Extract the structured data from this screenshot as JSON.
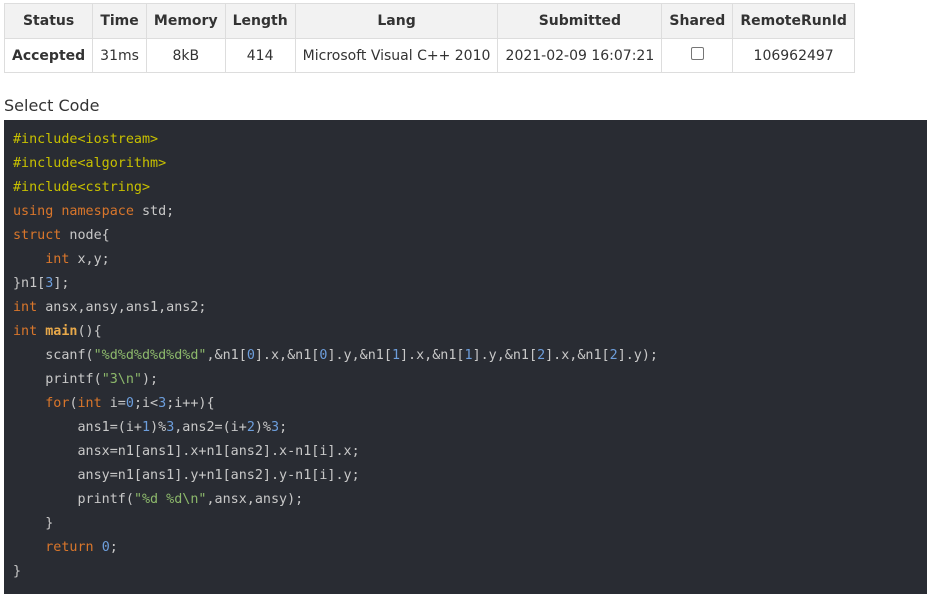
{
  "table": {
    "headers": [
      "Status",
      "Time",
      "Memory",
      "Length",
      "Lang",
      "Submitted",
      "Shared",
      "RemoteRunId"
    ],
    "row": {
      "status": "Accepted",
      "time": "31ms",
      "memory": "8kB",
      "length": "414",
      "lang": "Microsoft Visual C++ 2010",
      "submitted": "2021-02-09 16:07:21",
      "shared": false,
      "remote_run_id": "106962497"
    }
  },
  "select_code_label": "Select Code",
  "code_lines": [
    [
      [
        "pp",
        "#include<iostream>"
      ]
    ],
    [
      [
        "pp",
        "#include<algorithm>"
      ]
    ],
    [
      [
        "pp",
        "#include<cstring>"
      ]
    ],
    [
      [
        "kw",
        "using"
      ],
      [
        "pl",
        " "
      ],
      [
        "kw",
        "namespace"
      ],
      [
        "pl",
        " std;"
      ]
    ],
    [
      [
        "kw",
        "struct"
      ],
      [
        "pl",
        " node{"
      ]
    ],
    [
      [
        "pl",
        "    "
      ],
      [
        "kw",
        "int"
      ],
      [
        "pl",
        " x,y;"
      ]
    ],
    [
      [
        "pl",
        "}n1["
      ],
      [
        "num",
        "3"
      ],
      [
        "pl",
        "];"
      ]
    ],
    [
      [
        "kw",
        "int"
      ],
      [
        "pl",
        " ansx,ansy,ans1,ans2;"
      ]
    ],
    [
      [
        "kw",
        "int"
      ],
      [
        "pl",
        " "
      ],
      [
        "fn",
        "main"
      ],
      [
        "pl",
        "(){"
      ]
    ],
    [
      [
        "pl",
        "    scanf("
      ],
      [
        "str",
        "\"%d%d%d%d%d%d\""
      ],
      [
        "pl",
        ",&n1["
      ],
      [
        "num",
        "0"
      ],
      [
        "pl",
        "].x,&n1["
      ],
      [
        "num",
        "0"
      ],
      [
        "pl",
        "].y,&n1["
      ],
      [
        "num",
        "1"
      ],
      [
        "pl",
        "].x,&n1["
      ],
      [
        "num",
        "1"
      ],
      [
        "pl",
        "].y,&n1["
      ],
      [
        "num",
        "2"
      ],
      [
        "pl",
        "].x,&n1["
      ],
      [
        "num",
        "2"
      ],
      [
        "pl",
        "].y);"
      ]
    ],
    [
      [
        "pl",
        "    printf("
      ],
      [
        "str",
        "\"3\\n\""
      ],
      [
        "pl",
        ");"
      ]
    ],
    [
      [
        "pl",
        "    "
      ],
      [
        "kw",
        "for"
      ],
      [
        "pl",
        "("
      ],
      [
        "kw",
        "int"
      ],
      [
        "pl",
        " i="
      ],
      [
        "num",
        "0"
      ],
      [
        "pl",
        ";i<"
      ],
      [
        "num",
        "3"
      ],
      [
        "pl",
        ";i++){"
      ]
    ],
    [
      [
        "pl",
        "        ans1=(i+"
      ],
      [
        "num",
        "1"
      ],
      [
        "pl",
        ")%"
      ],
      [
        "num",
        "3"
      ],
      [
        "pl",
        ",ans2=(i+"
      ],
      [
        "num",
        "2"
      ],
      [
        "pl",
        ")%"
      ],
      [
        "num",
        "3"
      ],
      [
        "pl",
        ";"
      ]
    ],
    [
      [
        "pl",
        "        ansx=n1[ans1].x+n1[ans2].x-n1[i].x;"
      ]
    ],
    [
      [
        "pl",
        "        ansy=n1[ans1].y+n1[ans2].y-n1[i].y;"
      ]
    ],
    [
      [
        "pl",
        "        printf("
      ],
      [
        "str",
        "\"%d %d\\n\""
      ],
      [
        "pl",
        ",ansx,ansy);"
      ]
    ],
    [
      [
        "pl",
        "    }"
      ]
    ],
    [
      [
        "pl",
        "    "
      ],
      [
        "kw",
        "return"
      ],
      [
        "pl",
        " "
      ],
      [
        "num",
        "0"
      ],
      [
        "pl",
        ";"
      ]
    ],
    [
      [
        "pl",
        "}"
      ]
    ]
  ],
  "colors": {
    "accepted": "#5cb85c",
    "code_background": "#292c33",
    "preprocessor": "#c7c000",
    "keyword": "#d9762b",
    "string": "#8cb86b",
    "number": "#6d9edc"
  }
}
